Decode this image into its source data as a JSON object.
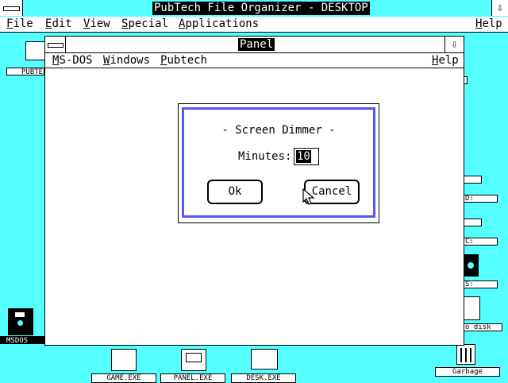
{
  "app": {
    "title": "PubTech File Organizer - DESKTOP",
    "arrow": "⇩"
  },
  "menubar": {
    "items": [
      "File",
      "Edit",
      "View",
      "Special",
      "Applications"
    ],
    "help": "Help"
  },
  "desktop_icons": {
    "left_folder_label": "PUBTE",
    "msdos_label": "MSDOS",
    "game_label": "GAME.EXE",
    "panel_label": "PANEL.EXE",
    "desk_label": "DESK.EXE",
    "garbage_label": "Garbage",
    "right_stub_d": "D:",
    "right_stub_c": "C:",
    "right_stub_s": "S:",
    "right_stub_disk": "o disk"
  },
  "panel": {
    "title": "Panel",
    "arrow": "⇩",
    "menu": [
      "MS-DOS",
      "Windows",
      "Pubtech"
    ],
    "help": "Help"
  },
  "dialog": {
    "title": "- Screen Dimmer -",
    "minutes_label": "Minutes:",
    "minutes_value": "10",
    "ok_label": "Ok",
    "cancel_label": "Cancel"
  },
  "colors": {
    "desktop": "#55ffff",
    "dialog_border": "#5555ff"
  }
}
